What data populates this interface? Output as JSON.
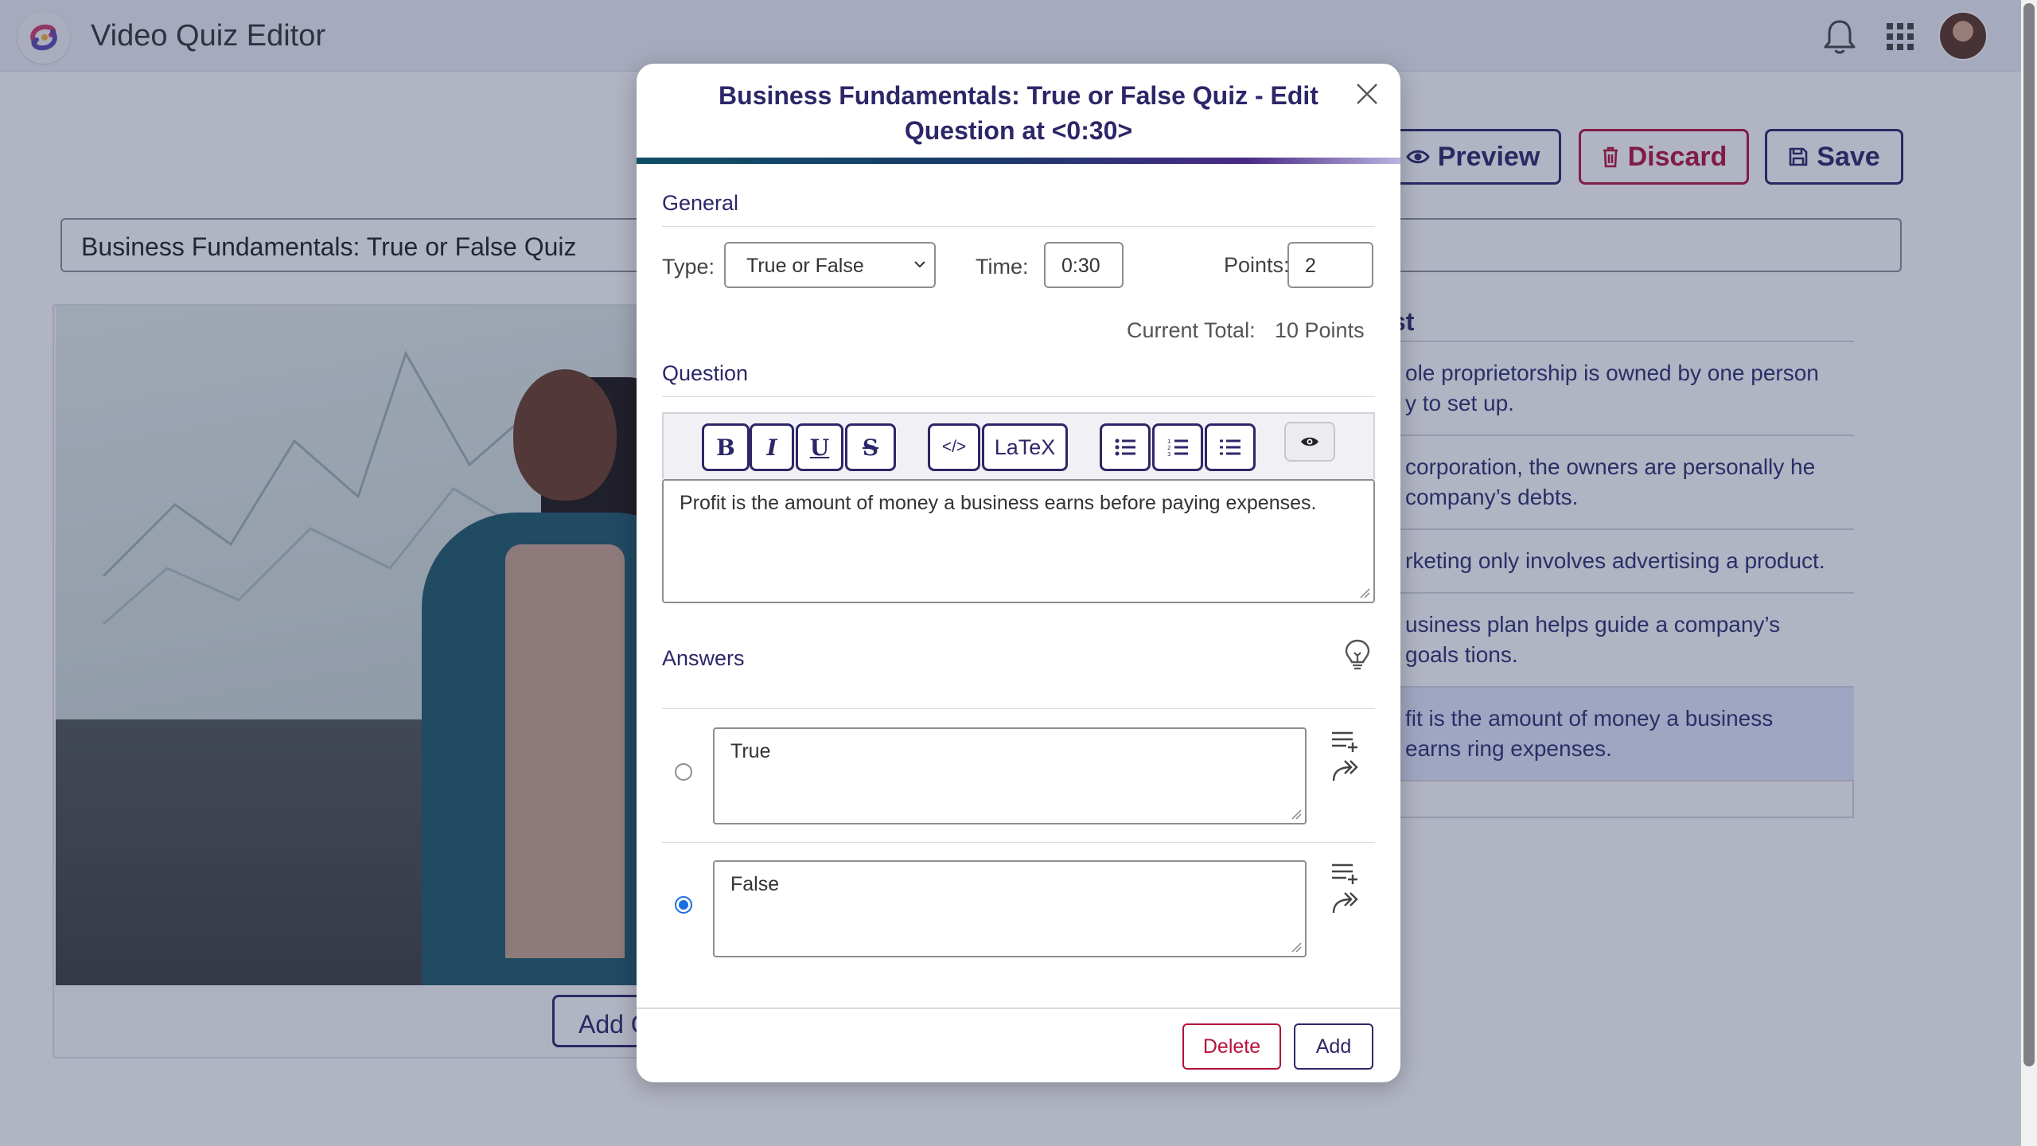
{
  "app": {
    "title": "Video Quiz Editor",
    "icons": [
      "app-logo-icon",
      "bell-icon",
      "apps-grid-icon",
      "user-avatar"
    ]
  },
  "actions": {
    "preview_label": "Preview",
    "discard_label": "Discard",
    "save_label": "Save"
  },
  "quiz": {
    "title_value": "Business Fundamentals: True or False Quiz"
  },
  "video": {
    "add_question_label": "Add Q"
  },
  "question_list": {
    "heading": "ist",
    "items": [
      {
        "text": "ole proprietorship is owned by one person y to set up."
      },
      {
        "text": "corporation, the owners are personally he company’s debts."
      },
      {
        "text": "rketing only involves advertising a product."
      },
      {
        "text": "usiness plan helps guide a company’s goals tions."
      },
      {
        "text": "fit is the amount of money a business earns ring expenses."
      }
    ]
  },
  "modal": {
    "title": "Business Fundamentals: True or False Quiz - Edit Question at <0:30>",
    "general": {
      "section_label": "General",
      "type_label": "Type:",
      "type_value": "True or False",
      "time_label": "Time:",
      "time_value": "0:30",
      "points_label": "Points:",
      "points_value": "2",
      "total_label": "Current Total:",
      "total_value": "10 Points"
    },
    "question": {
      "section_label": "Question",
      "toolbar": {
        "bold": "B",
        "italic": "I",
        "underline": "U",
        "strike": "S",
        "code": "</>",
        "latex": "LaTeX"
      },
      "text": "Profit is the amount of money a business earns before paying expenses."
    },
    "answers": {
      "section_label": "Answers",
      "items": [
        {
          "text": "True",
          "selected": false
        },
        {
          "text": "False",
          "selected": true
        }
      ]
    },
    "delete_label": "Delete",
    "add_label": "Add"
  },
  "colors": {
    "brand": "#2d2769",
    "danger": "#b3123a",
    "radio_selected": "#1a6fe0",
    "selected_row": "#e3eafc"
  }
}
